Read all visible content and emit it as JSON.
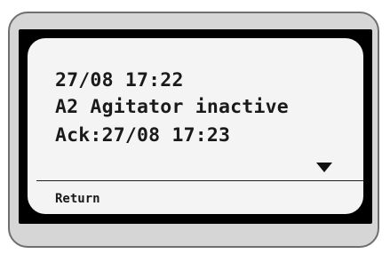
{
  "screen": {
    "lines": [
      "27/08 17:22",
      "A2 Agitator inactive",
      "Ack:27/08 17:23"
    ],
    "scroll_indicator_icon": "down-triangle-icon",
    "softkey_label": "Return"
  },
  "colors": {
    "housing": "#d6d6d6",
    "bezel": "#000000",
    "lcd_background": "#f4f4f4",
    "text": "#1a1a1a"
  }
}
